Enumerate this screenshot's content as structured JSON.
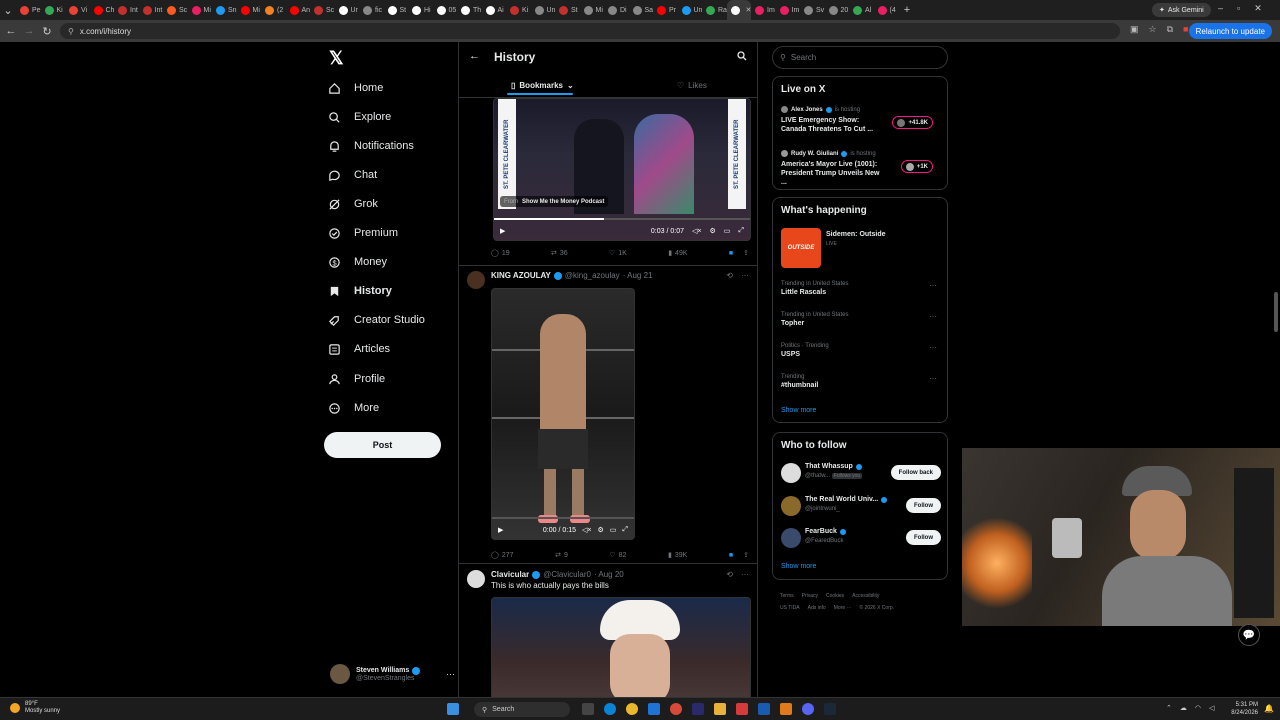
{
  "browser": {
    "tabs": [
      "Pe",
      "Ki",
      "Vi",
      "Ch",
      "Int",
      "Int",
      "Sc",
      "Mi",
      "Sn",
      "Mi",
      "(2",
      "An",
      "Sc",
      "Ur",
      "fic",
      "St",
      "Hi",
      "05",
      "Th",
      "Ai",
      "Ki",
      "Un",
      "St",
      "Mi",
      "Di",
      "Sa",
      "Pr",
      "Un",
      "Ra",
      "",
      "Im",
      "Im",
      "Sv",
      "20",
      "Al",
      "(4"
    ],
    "active_tab_index": 29,
    "url": "x.com/i/history",
    "ask_gemini": "Ask Gemini",
    "relaunch": "Relaunch to update"
  },
  "sidebar": {
    "logo": "𝕏",
    "items": [
      {
        "label": "Home",
        "icon": "home-icon"
      },
      {
        "label": "Explore",
        "icon": "search-icon"
      },
      {
        "label": "Notifications",
        "icon": "bell-icon"
      },
      {
        "label": "Chat",
        "icon": "chat-icon"
      },
      {
        "label": "Grok",
        "icon": "grok-icon"
      },
      {
        "label": "Premium",
        "icon": "verified-icon"
      },
      {
        "label": "Money",
        "icon": "money-icon"
      },
      {
        "label": "History",
        "icon": "bookmark-icon"
      },
      {
        "label": "Creator Studio",
        "icon": "rocket-icon"
      },
      {
        "label": "Articles",
        "icon": "article-icon"
      },
      {
        "label": "Profile",
        "icon": "user-icon"
      },
      {
        "label": "More",
        "icon": "more-circle-icon"
      }
    ],
    "post_button": "Post",
    "account": {
      "name": "Steven Williams",
      "handle": "@StevenStrangles"
    }
  },
  "timeline": {
    "title": "History",
    "subtabs": {
      "bookmarks": "Bookmarks",
      "likes": "Likes"
    },
    "post1": {
      "source_label": "From",
      "source": "Show Me the Money Podcast",
      "time": "0:03 / 0:07",
      "banner_left": "ST. PETE CLEARWATER",
      "banner_right": "ST. PETE CLEARWATER",
      "replies": "19",
      "reposts": "36",
      "likes": "1K",
      "views": "49K"
    },
    "post2": {
      "name": "KING AZOULAY",
      "handle": "@king_azoulay",
      "date": "· Aug 21",
      "time": "0:00 / 0:15",
      "replies": "277",
      "reposts": "9",
      "likes": "82",
      "views": "39K"
    },
    "post3": {
      "name": "Clavicular",
      "handle": "@Clavicular0",
      "date": "· Aug 20",
      "text": "This is who actually pays the bills"
    }
  },
  "right": {
    "search_placeholder": "Search",
    "live": {
      "title": "Live on X",
      "items": [
        {
          "host": "Alex Jones",
          "status": "is hosting",
          "title": "LIVE Emergency Show: Canada Threatens To Cut ...",
          "count": "+41.8K"
        },
        {
          "host": "Rudy W. Giuliani",
          "status": "is hosting",
          "title": "America's Mayor Live (1001): President Trump Unveils New ...",
          "count": "+1K"
        }
      ]
    },
    "happening": {
      "title": "What's happening",
      "featured": {
        "name": "Sidemen: Outside",
        "status": "LIVE",
        "thumb": "OUTSIDE"
      },
      "trends": [
        {
          "cat": "Trending in United States",
          "name": "Little Rascals"
        },
        {
          "cat": "Trending in United States",
          "name": "Topher"
        },
        {
          "cat": "Politics · Trending",
          "name": "USPS"
        },
        {
          "cat": "Trending",
          "name": "#thumbnail"
        }
      ],
      "show_more": "Show more"
    },
    "who": {
      "title": "Who to follow",
      "items": [
        {
          "name": "That Whassup",
          "handle": "@thatw...",
          "badge": "Follows you",
          "button": "Follow back"
        },
        {
          "name": "The Real World Univ...",
          "handle": "@jointrwuni_",
          "badge": "",
          "button": "Follow"
        },
        {
          "name": "FearBuck",
          "handle": "@FearedBuck",
          "badge": "",
          "button": "Follow"
        }
      ],
      "show_more": "Show more"
    },
    "footer": [
      "Terms",
      "Privacy",
      "Cookies",
      "Accessibility",
      "US TIDA",
      "Ads info",
      "More ···",
      "© 2026 X Corp."
    ]
  },
  "taskbar": {
    "weather_temp": "89°F",
    "weather_desc": "Mostly sunny",
    "search": "Search",
    "time": "5:31 PM",
    "date": "8/24/2026"
  },
  "colors": {
    "accent": "#1d9bf0",
    "live": "#f91880",
    "border": "#2f3336",
    "muted": "#71767b"
  }
}
